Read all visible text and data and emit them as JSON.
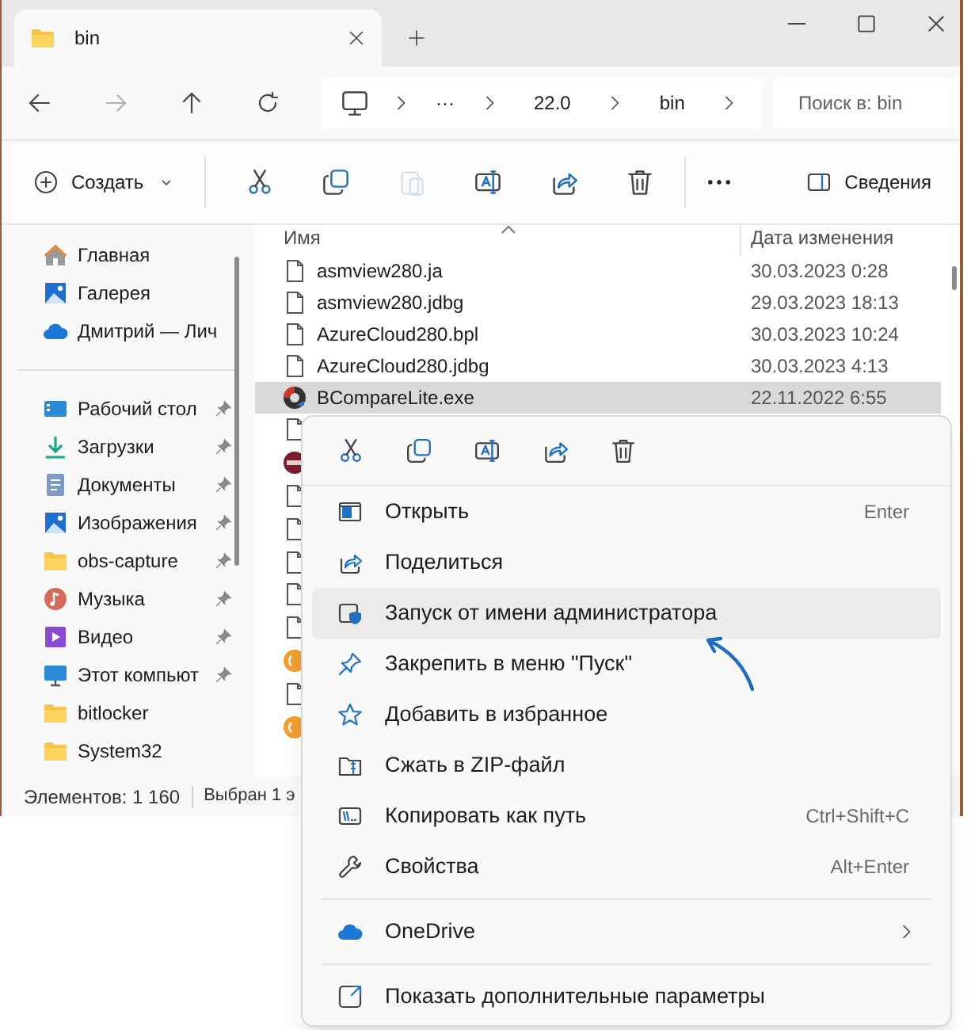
{
  "tab": {
    "title": "bin"
  },
  "address": {
    "crumbs": [
      "···",
      "22.0",
      "bin"
    ],
    "search_placeholder": "Поиск в: bin"
  },
  "toolbar": {
    "new_label": "Создать",
    "actions": [
      {
        "kind": "cut",
        "disabled": false
      },
      {
        "kind": "copy",
        "disabled": false
      },
      {
        "kind": "paste",
        "disabled": true
      },
      {
        "kind": "rename",
        "disabled": false
      },
      {
        "kind": "share",
        "disabled": false
      },
      {
        "kind": "delete",
        "disabled": false
      }
    ],
    "details_label": "Сведения"
  },
  "sidebar": {
    "top": [
      {
        "kind": "home",
        "label": "Главная"
      },
      {
        "kind": "gallery",
        "label": "Галерея"
      },
      {
        "kind": "cloud",
        "label": "Дмитрий — Лич"
      }
    ],
    "items": [
      {
        "kind": "desktop",
        "label": "Рабочий стол",
        "pinned": true
      },
      {
        "kind": "download",
        "label": "Загрузки",
        "pinned": true
      },
      {
        "kind": "documents",
        "label": "Документы",
        "pinned": true
      },
      {
        "kind": "pictures",
        "label": "Изображения",
        "pinned": true
      },
      {
        "kind": "folder",
        "label": "obs-capture",
        "pinned": true
      },
      {
        "kind": "music",
        "label": "Музыка",
        "pinned": true
      },
      {
        "kind": "video",
        "label": "Видео",
        "pinned": true
      },
      {
        "kind": "computer",
        "label": "Этот компьют",
        "pinned": true
      },
      {
        "kind": "folder",
        "label": "bitlocker",
        "pinned": false
      },
      {
        "kind": "folder",
        "label": "System32",
        "pinned": false
      }
    ]
  },
  "file_list": {
    "columns": [
      "Имя",
      "Дата изменения"
    ],
    "rows": [
      {
        "kind": "file",
        "name": "asmview280.ja",
        "date": "30.03.2023 0:28",
        "selected": false
      },
      {
        "kind": "file",
        "name": "asmview280.jdbg",
        "date": "29.03.2023 18:13",
        "selected": false
      },
      {
        "kind": "file",
        "name": "AzureCloud280.bpl",
        "date": "30.03.2023 10:24",
        "selected": false
      },
      {
        "kind": "file",
        "name": "AzureCloud280.jdbg",
        "date": "30.03.2023 4:13",
        "selected": false
      },
      {
        "kind": "app",
        "name": "BCompareLite.exe",
        "date": "22.11.2022 6:55",
        "selected": true
      }
    ],
    "covered_rows": [
      {
        "kind": "file"
      },
      {
        "kind": "archive"
      },
      {
        "kind": "file"
      },
      {
        "kind": "file"
      },
      {
        "kind": "file"
      },
      {
        "kind": "file"
      },
      {
        "kind": "file"
      },
      {
        "kind": "orange"
      },
      {
        "kind": "file"
      },
      {
        "kind": "orange"
      }
    ]
  },
  "status_bar": {
    "count": "Элементов: 1 160",
    "selection": "Выбран 1 э"
  },
  "context_menu": {
    "quick_actions": [
      {
        "kind": "cut"
      },
      {
        "kind": "copy"
      },
      {
        "kind": "rename"
      },
      {
        "kind": "share"
      },
      {
        "kind": "delete"
      }
    ],
    "groups": [
      [
        {
          "kind": "open",
          "label": "Открыть",
          "shortcut": "Enter",
          "selected": false
        },
        {
          "kind": "share",
          "label": "Поделиться",
          "selected": false
        },
        {
          "kind": "admin",
          "label": "Запуск от имени администратора",
          "selected": true
        },
        {
          "kind": "pin",
          "label": "Закрепить в меню \"Пуск\"",
          "selected": false
        },
        {
          "kind": "star",
          "label": "Добавить в избранное",
          "selected": false
        },
        {
          "kind": "zip",
          "label": "Сжать в ZIP-файл",
          "selected": false
        },
        {
          "kind": "path",
          "label": "Копировать как путь",
          "shortcut": "Ctrl+Shift+C",
          "selected": false
        },
        {
          "kind": "properties",
          "label": "Свойства",
          "shortcut": "Alt+Enter",
          "selected": false
        }
      ],
      [
        {
          "kind": "onedrive",
          "label": "OneDrive",
          "submenu": true,
          "selected": false
        }
      ],
      [
        {
          "kind": "more",
          "label": "Показать дополнительные параметры",
          "selected": false
        }
      ]
    ]
  }
}
